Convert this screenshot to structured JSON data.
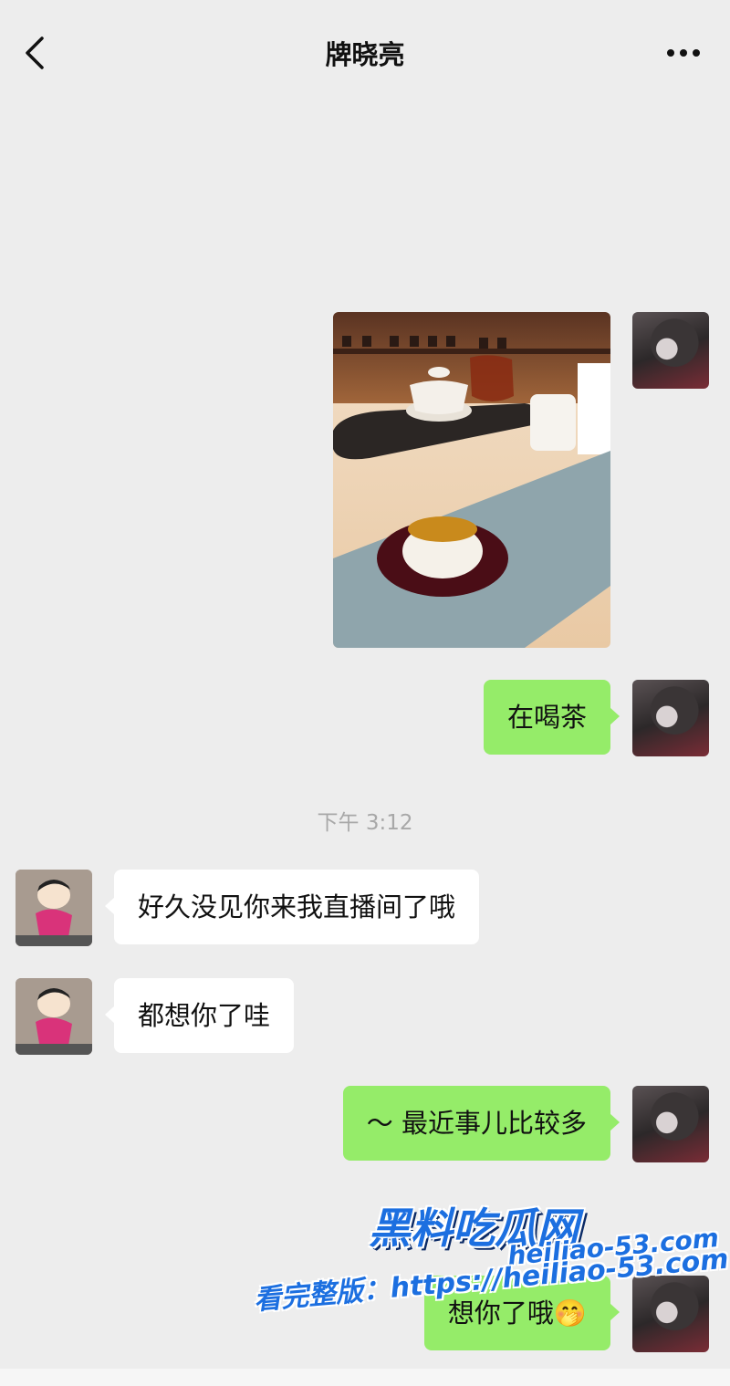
{
  "header": {
    "title": "牌晓亮",
    "back_icon": "chevron-left-icon",
    "more_icon": "more-dots-icon"
  },
  "messages": [
    {
      "direction": "out",
      "type": "image",
      "image": "tea-set-photo"
    },
    {
      "direction": "out",
      "type": "text",
      "text": "在喝茶"
    },
    {
      "type": "timestamp",
      "text": "下午 3:12"
    },
    {
      "direction": "in",
      "type": "text",
      "text": "好久没见你来我直播间了哦"
    },
    {
      "direction": "in",
      "type": "text",
      "text": "都想你了哇"
    },
    {
      "direction": "out",
      "type": "text",
      "text": "～ 最近事儿比较多"
    },
    {
      "direction": "out",
      "type": "text",
      "text": "想你了哦🤭"
    }
  ],
  "watermark": {
    "logo": "黑料吃瓜网",
    "url": "heiliao-53.com",
    "full_version": "看完整版：https://heiliao-53.com"
  },
  "colors": {
    "background": "#ededed",
    "outgoing_bubble": "#95ec69",
    "incoming_bubble": "#ffffff",
    "watermark_blue": "#1c6fe0"
  }
}
